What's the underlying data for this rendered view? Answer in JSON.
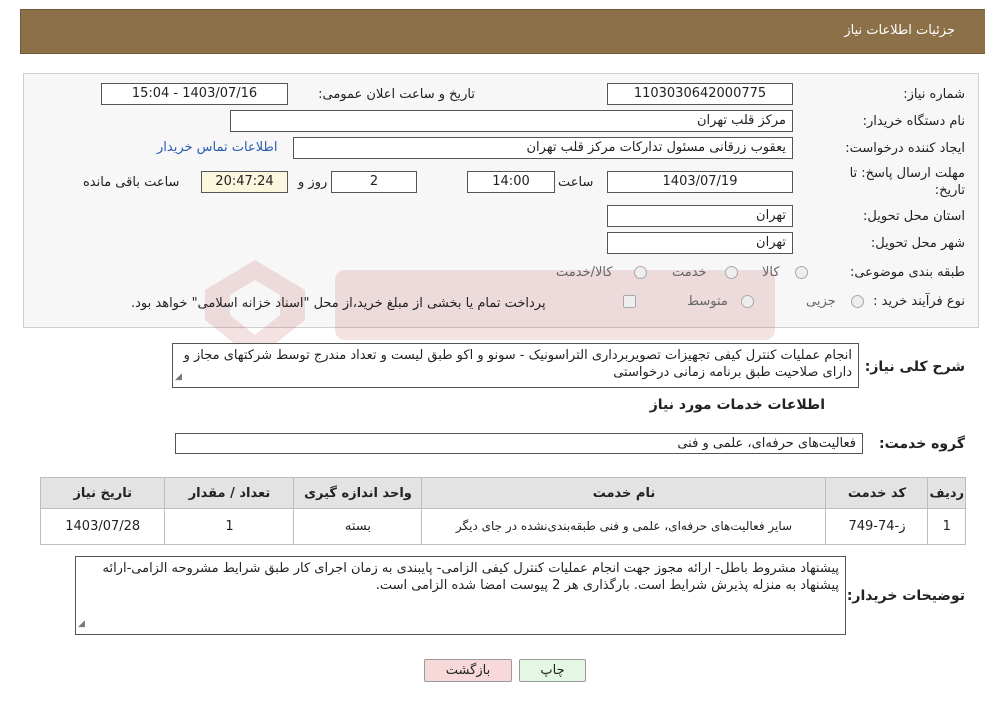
{
  "header": {
    "title": "جزئیات اطلاعات نیاز"
  },
  "form": {
    "need_number_label": "شماره نیاز:",
    "need_number": "1103030642000775",
    "announce_label": "تاریخ و ساعت اعلان عمومی:",
    "announce_value": "1403/07/16 - 15:04",
    "buyer_org_label": "نام دستگاه خریدار:",
    "buyer_org": "مرکز قلب تهران",
    "requester_label": "ایجاد کننده درخواست:",
    "requester": "یعقوب زرقانی مسئول تداركات مرکز قلب تهران",
    "contact_link": "اطلاعات تماس خریدار",
    "deadline_label_1": "مهلت ارسال پاسخ: تا",
    "deadline_label_2": "تاریخ:",
    "deadline_date": "1403/07/19",
    "time_label": "ساعت",
    "deadline_time": "14:00",
    "days": "2",
    "days_label": "روز و",
    "remaining_time": "20:47:24",
    "remaining_label": "ساعت باقی مانده",
    "province_label": "استان محل تحویل:",
    "province": "تهران",
    "city_label": "شهر محل تحویل:",
    "city": "تهران",
    "category_label": "طبقه بندی موضوعی:",
    "category_options": [
      "کالا",
      "خدمت",
      "کالا/خدمت"
    ],
    "process_label": "نوع فرآیند خرید :",
    "process_options": [
      "جزیی",
      "متوسط"
    ],
    "payment_note": "پرداخت تمام یا بخشی از مبلغ خرید،از محل \"اسناد خزانه اسلامی\" خواهد بود."
  },
  "description": {
    "label": "شرح کلی نیاز:",
    "text": "انجام عملیات کنترل کیفی تجهیزات تصویربرداری التراسونیک - سونو و اکو طبق لیست و تعداد  مندرج توسط شرکتهای مجاز و دارای صلاحیت طبق برنامه زمانی درخواستی"
  },
  "services": {
    "section_title": "اطلاعات خدمات مورد نیاز",
    "group_label": "گروه خدمت:",
    "group_value": "فعالیت‌های حرفه‌ای، علمی و فنی",
    "columns": [
      "ردیف",
      "کد خدمت",
      "نام خدمت",
      "واحد اندازه گیری",
      "تعداد / مقدار",
      "تاریخ نیاز"
    ],
    "rows": [
      {
        "row": "1",
        "code": "ز-74-749",
        "name": "سایر فعالیت‌های حرفه‌ای، علمی و فنی طبقه‌بندی‌نشده در جای دیگر",
        "unit": "بسته",
        "qty": "1",
        "date": "1403/07/28"
      }
    ]
  },
  "buyer_notes": {
    "label": "توضیحات خریدار:",
    "text": "پیشنهاد مشروط باطل- ارائه مجوز جهت انجام عملیات کنترل کیفی الزامی- پایبندی به زمان اجرای کار طبق شرایط مشروحه الزامی-ارائه پیشنهاد به منزله پذیرش شرایط است. بارگذاری هر 2 پیوست امضا شده الزامی است."
  },
  "buttons": {
    "print": "چاپ",
    "back": "بازگشت"
  },
  "colors": {
    "header": "#8b7048",
    "back_button": "#f7d9d9",
    "print_button": "#e4f6e4",
    "link": "#2a5db0"
  }
}
